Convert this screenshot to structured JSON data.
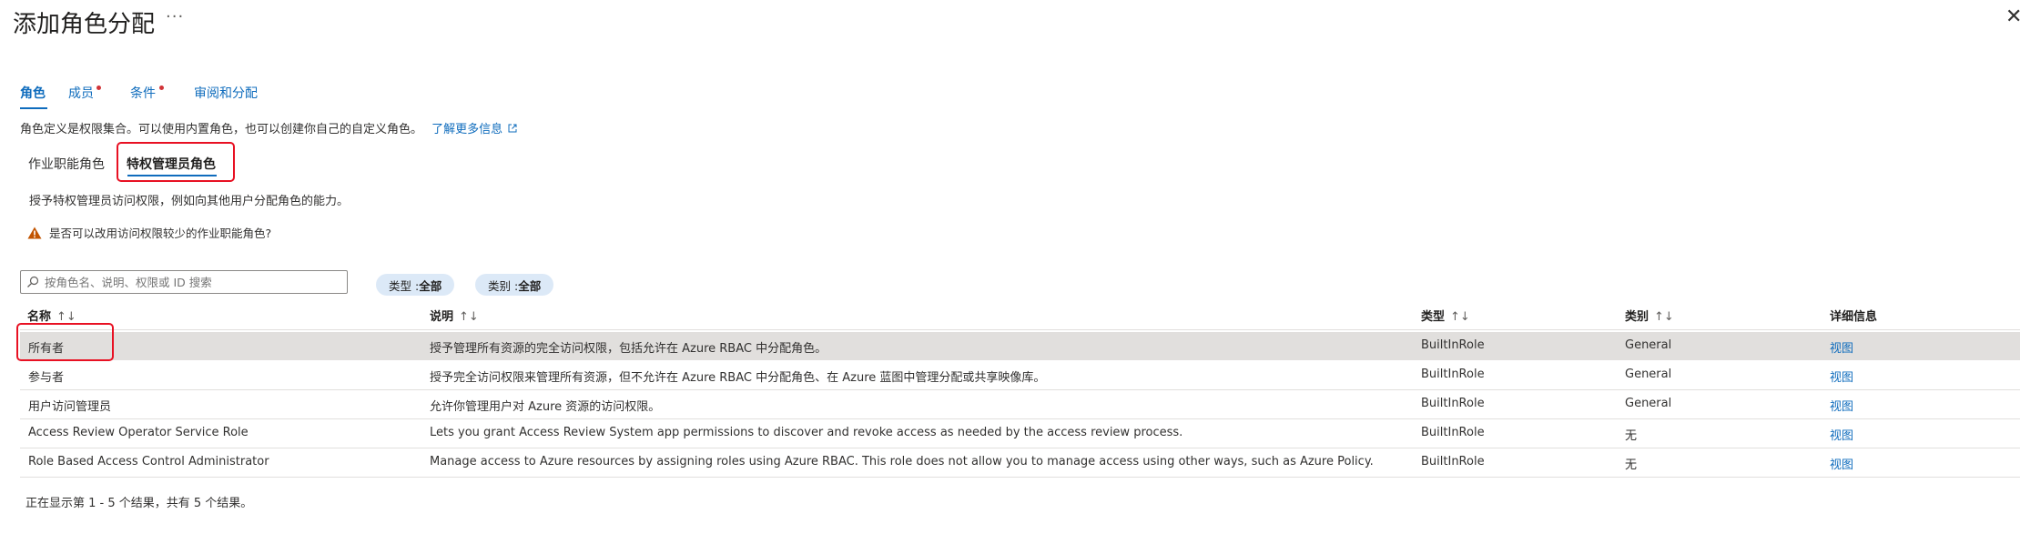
{
  "header": {
    "title": "添加角色分配",
    "more": "···",
    "close": "✕"
  },
  "tabs": [
    {
      "label": "角色"
    },
    {
      "label": "成员"
    },
    {
      "label": "条件"
    },
    {
      "label": "审阅和分配"
    }
  ],
  "description": {
    "text": "角色定义是权限集合。可以使用内置角色，也可以创建你自己的自定义角色。",
    "learn_more": "了解更多信息"
  },
  "subtabs": [
    {
      "label": "作业职能角色"
    },
    {
      "label": "特权管理员角色"
    }
  ],
  "subtab_description": "授予特权管理员访问权限，例如向其他用户分配角色的能力。",
  "warning": {
    "text": "是否可以改用访问权限较少的作业职能角色?"
  },
  "search": {
    "placeholder": "按角色名、说明、权限或 ID 搜索"
  },
  "filters": [
    {
      "key": "类型 : ",
      "value": "全部"
    },
    {
      "key": "类别 : ",
      "value": "全部"
    }
  ],
  "table": {
    "columns": [
      "名称",
      "说明",
      "类型",
      "类别",
      "详细信息"
    ],
    "sort_glyph": "↑↓",
    "rows": [
      {
        "name": "所有者",
        "description": "授予管理所有资源的完全访问权限，包括允许在 Azure RBAC 中分配角色。",
        "type": "BuiltInRole",
        "category": "General",
        "details": "视图"
      },
      {
        "name": "参与者",
        "description": "授予完全访问权限来管理所有资源，但不允许在 Azure RBAC 中分配角色、在 Azure 蓝图中管理分配或共享映像库。",
        "type": "BuiltInRole",
        "category": "General",
        "details": "视图"
      },
      {
        "name": "用户访问管理员",
        "description": "允许你管理用户对 Azure 资源的访问权限。",
        "type": "BuiltInRole",
        "category": "General",
        "details": "视图"
      },
      {
        "name": "Access Review Operator Service Role",
        "description": "Lets you grant Access Review System app permissions to discover and revoke access as needed by the access review process.",
        "type": "BuiltInRole",
        "category": "无",
        "details": "视图"
      },
      {
        "name": "Role Based Access Control Administrator",
        "description": "Manage access to Azure resources by assigning roles using Azure RBAC. This role does not allow you to manage access using other ways, such as Azure Policy.",
        "type": "BuiltInRole",
        "category": "无",
        "details": "视图"
      }
    ]
  },
  "footer": {
    "text": "正在显示第 1 - 5 个结果，共有 5 个结果。"
  },
  "colors": {
    "accent": "#0f6cbd",
    "required_dot": "#d13438",
    "highlight_box": "#e81123",
    "warning": "#c25400",
    "selected_row": "#e1dfdd"
  }
}
